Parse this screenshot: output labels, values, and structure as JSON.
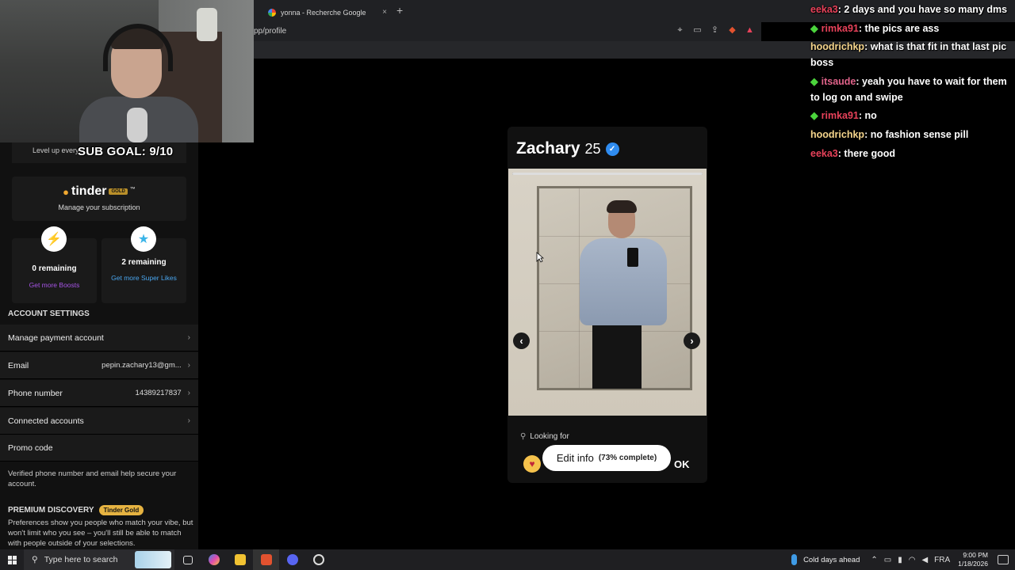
{
  "browser": {
    "tab_title": "yonna - Recherche Google",
    "tab_close": "×",
    "new_tab": "+",
    "url": "pp/profile"
  },
  "overlay": {
    "sub_goal": "SUB GOAL: 9/10"
  },
  "left_panel": {
    "level_up_text": "Level up every",
    "tinder_brand": "tinder",
    "gold_badge": "GOLD",
    "tm": "™",
    "manage_subscription": "Manage your subscription",
    "boosts": {
      "remaining": "0 remaining",
      "link": "Get more Boosts"
    },
    "super_likes": {
      "remaining": "2 remaining",
      "link": "Get more Super Likes"
    },
    "account_settings_heading": "ACCOUNT SETTINGS",
    "rows": [
      {
        "label": "Manage payment account",
        "value": ""
      },
      {
        "label": "Email",
        "value": "pepin.zachary13@gm..."
      },
      {
        "label": "Phone number",
        "value": "14389217837"
      },
      {
        "label": "Connected accounts",
        "value": ""
      },
      {
        "label": "Promo code",
        "value": ""
      }
    ],
    "verify_note": "Verified phone number and email help secure your account.",
    "premium_heading": "PREMIUM DISCOVERY",
    "premium_badge": "Tinder Gold",
    "premium_note": "Preferences show you people who match your vibe, but won't limit who you see – you'll still be able to match with people outside of your selections."
  },
  "profile": {
    "name": "Zachary",
    "age": "25",
    "looking_for": "Looking for",
    "edit_info": "Edit info",
    "completion": "(73% complete)",
    "ok": "OK"
  },
  "chat": [
    {
      "user": "eeka3",
      "color": "#e8425a",
      "badge": false,
      "text": ": 2 days and you have so many dms"
    },
    {
      "user": "rimka91",
      "color": "#e8425a",
      "badge": true,
      "text": ": the pics are ass"
    },
    {
      "user": "hoodrichkp",
      "color": "#f5d58c",
      "badge": false,
      "text": ": what is that fit in that last pic boss"
    },
    {
      "user": "itsaude",
      "color": "#e0638a",
      "badge": true,
      "text": ": yeah you have to wait for them to log on and swipe"
    },
    {
      "user": "rimka91",
      "color": "#e8425a",
      "badge": true,
      "text": ": no"
    },
    {
      "user": "hoodrichkp",
      "color": "#f5d58c",
      "badge": false,
      "text": ": no fashion sense pill"
    },
    {
      "user": "eeka3",
      "color": "#e8425a",
      "badge": false,
      "text": ": there good"
    }
  ],
  "taskbar": {
    "search_placeholder": "Type here to search",
    "weather": "Cold days ahead",
    "language": "FRA",
    "time": "9:00 PM",
    "date": "1/18/2026"
  }
}
